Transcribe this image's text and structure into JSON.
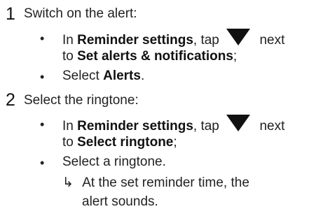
{
  "cut_top": "...",
  "steps": [
    {
      "number": "1",
      "title": "Switch on the alert:",
      "bullets": [
        {
          "pre": "In ",
          "bold1": "Reminder settings",
          "mid": ", tap",
          "post": "next",
          "l2pre": "to ",
          "bold2": "Set alerts & notifications",
          "l2post": ";",
          "icon": "dropdown-triangle-icon"
        },
        {
          "pre": "Select ",
          "bold": "Alerts",
          "post": "."
        }
      ]
    },
    {
      "number": "2",
      "title": "Select the ringtone:",
      "bullets": [
        {
          "pre": "In ",
          "bold1": "Reminder settings",
          "mid": ", tap",
          "post": "next",
          "l2pre": "to ",
          "bold2": "Select ringtone",
          "l2post": ";",
          "icon": "dropdown-triangle-icon"
        },
        {
          "text": "Select a ringtone."
        }
      ],
      "result": {
        "arrow": "↳",
        "line1": "At the set reminder time, the",
        "line2": "alert sounds."
      }
    }
  ],
  "bullet_char": "•"
}
